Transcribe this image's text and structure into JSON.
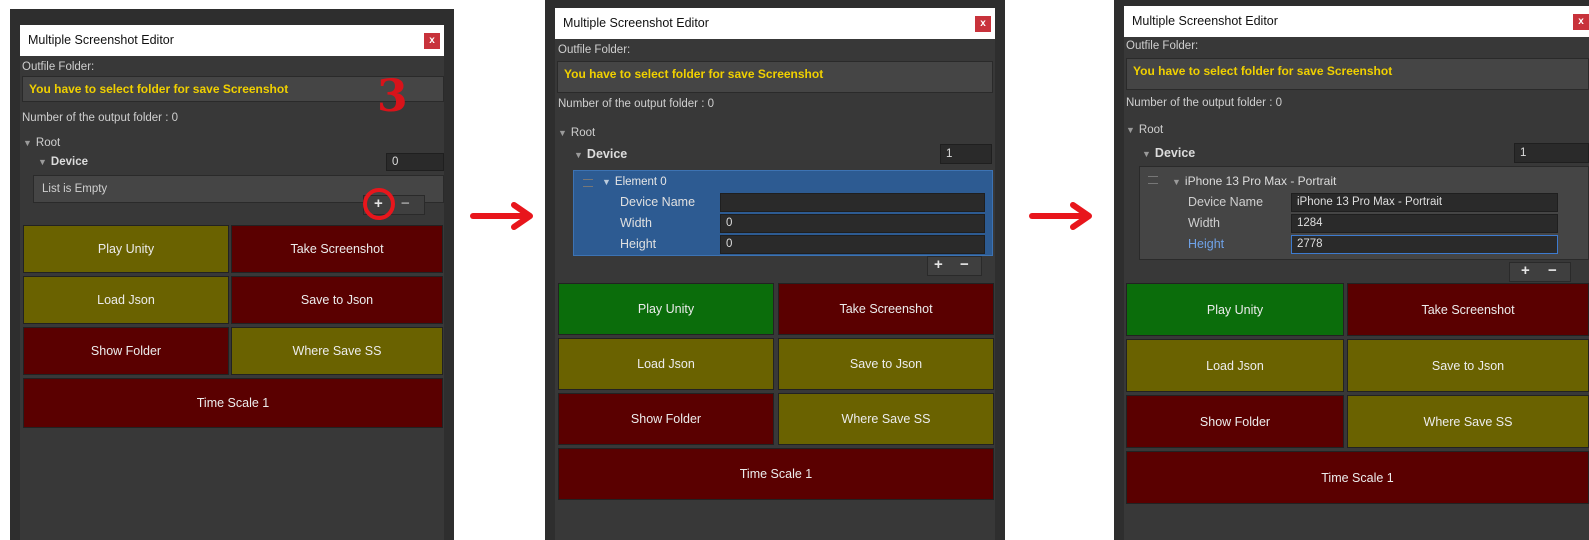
{
  "window_title": "Multiple Screenshot Editor",
  "close_label": "x",
  "outfile_label": "Outfile Folder:",
  "warning": "You have to select folder for save Screenshot",
  "output_count": "Number of the output folder : 0",
  "root_label": "Root",
  "device_label": "Device",
  "step_number": "3",
  "plus": "+",
  "minus": "−",
  "buttons": {
    "play": "Play Unity",
    "take": "Take Screenshot",
    "load": "Load Json",
    "save": "Save to Json",
    "show": "Show Folder",
    "where": "Where Save SS",
    "time": "Time Scale 1"
  },
  "fields": {
    "device_name": "Device Name",
    "width": "Width",
    "height": "Height"
  },
  "panel1": {
    "device_count": "0",
    "empty_text": "List is Empty"
  },
  "panel2": {
    "device_count": "1",
    "element_title": "Element 0",
    "device_name_value": "",
    "width_value": "0",
    "height_value": "0"
  },
  "panel3": {
    "device_count": "1",
    "element_title": "iPhone 13 Pro Max  - Portrait",
    "device_name_value": "iPhone 13 Pro Max  - Portrait",
    "width_value": "1284",
    "height_value": "2778"
  },
  "colors": {
    "olive": "#6a6200",
    "maroon": "#5a0000",
    "green": "#0b6d0b",
    "warning": "#f0d000",
    "accent_red": "#e8161c",
    "selection_blue": "#2d5b92"
  }
}
